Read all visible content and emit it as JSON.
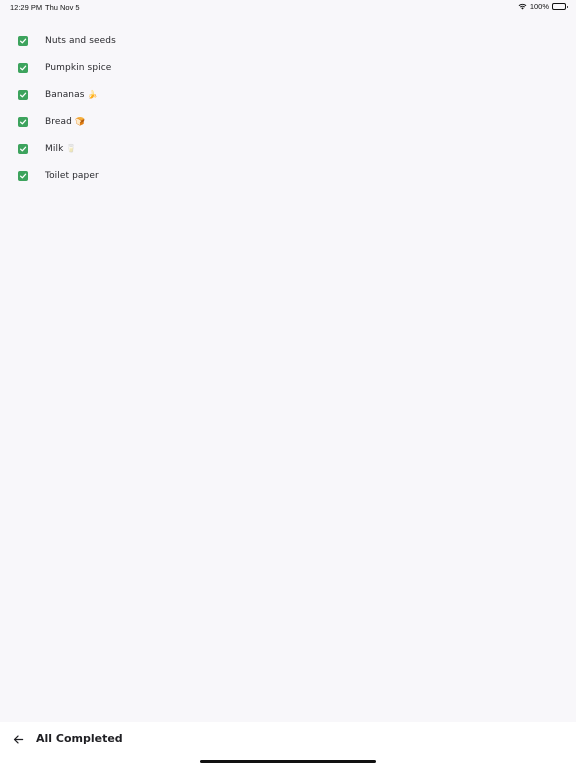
{
  "status_bar": {
    "time": "12:29 PM",
    "date": "Thu Nov 5",
    "battery": "100%"
  },
  "list": {
    "items": [
      {
        "label": "Nuts and seeds",
        "emoji": "",
        "checked": true
      },
      {
        "label": "Pumpkin spice",
        "emoji": "",
        "checked": true
      },
      {
        "label": "Bananas",
        "emoji": "🍌",
        "checked": true
      },
      {
        "label": "Bread",
        "emoji": "🍞",
        "checked": true
      },
      {
        "label": "Milk",
        "emoji": "🥛",
        "checked": true
      },
      {
        "label": "Toilet paper",
        "emoji": "",
        "checked": true
      }
    ]
  },
  "bottom_bar": {
    "title": "All Completed",
    "back_icon": "arrow-left-icon"
  },
  "colors": {
    "checkbox": "#3da35d",
    "background": "#f8f7fa",
    "bottom_bar": "#ffffff"
  }
}
